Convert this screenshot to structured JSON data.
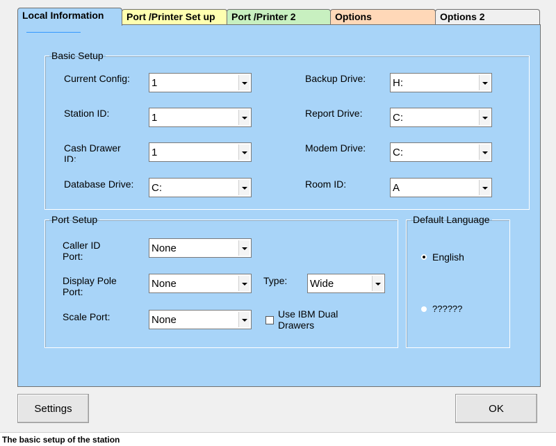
{
  "tabs": [
    {
      "label": "Local Information",
      "color": "#a8d4f8"
    },
    {
      "label": "Port /Printer Set up",
      "color": "#ffffb0"
    },
    {
      "label": "Port /Printer 2",
      "color": "#c8f0c0"
    },
    {
      "label": "Options",
      "color": "#ffd8b8"
    },
    {
      "label": "Options 2",
      "color": "#f0f0f0"
    }
  ],
  "basic_setup": {
    "legend": "Basic Setup",
    "current_config": {
      "label": "Current Config:",
      "value": "1"
    },
    "station_id": {
      "label": "Station ID:",
      "value": "1"
    },
    "cash_drawer_id": {
      "label": "Cash Drawer ID:",
      "value": "1"
    },
    "database_drive": {
      "label": "Database Drive:",
      "value": "C:"
    },
    "backup_drive": {
      "label": "Backup Drive:",
      "value": "H:"
    },
    "report_drive": {
      "label": "Report Drive:",
      "value": "C:"
    },
    "modem_drive": {
      "label": "Modem Drive:",
      "value": "C:"
    },
    "room_id": {
      "label": "Room ID:",
      "value": "A"
    }
  },
  "port_setup": {
    "legend": "Port Setup",
    "caller_id_port": {
      "label": "Caller ID Port:",
      "value": "None"
    },
    "display_pole_port": {
      "label": "Display Pole Port:",
      "value": "None"
    },
    "type": {
      "label": "Type:",
      "value": "Wide"
    },
    "scale_port": {
      "label": "Scale Port:",
      "value": "None"
    },
    "ibm_dual_drawers": {
      "label": "Use IBM Dual Drawers",
      "checked": false
    }
  },
  "default_language": {
    "legend": "Default Language",
    "options": [
      {
        "label": "English",
        "selected": true
      },
      {
        "label": "??????",
        "selected": false
      }
    ]
  },
  "buttons": {
    "settings": "Settings",
    "ok": "OK"
  },
  "status_bar": "The basic setup of the station"
}
